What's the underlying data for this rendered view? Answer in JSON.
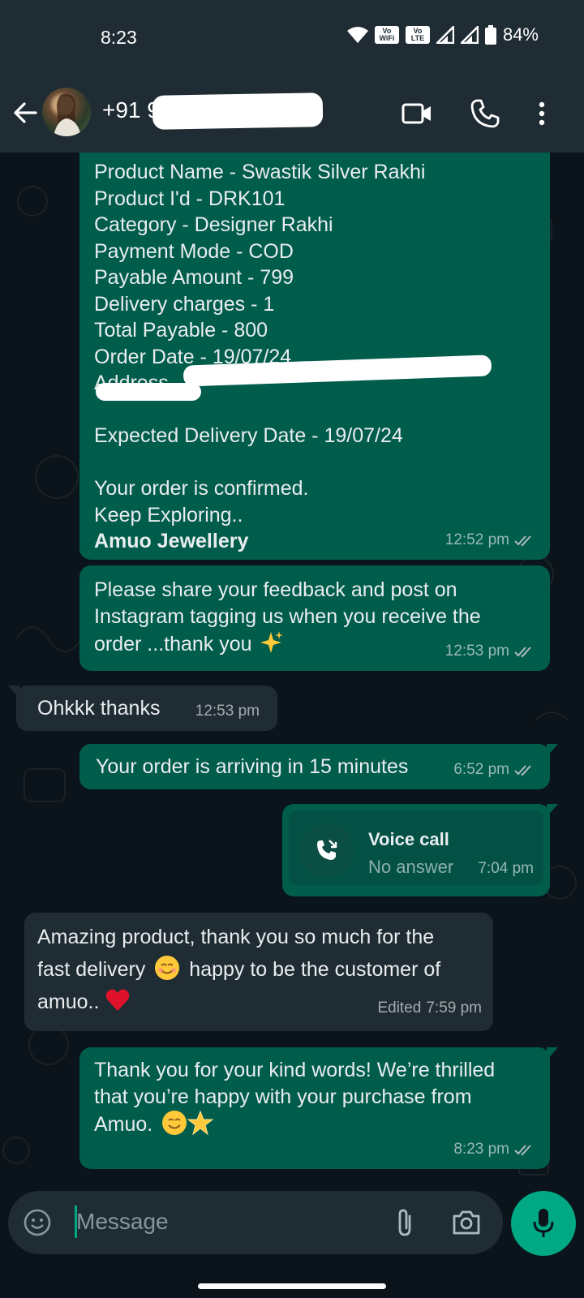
{
  "status_bar": {
    "time": "8:23",
    "wifi_badge": "Vo WiFi",
    "lte_badge": "Vo LTE",
    "battery": "84%"
  },
  "header": {
    "contact_prefix": "+91",
    "contact_rest": "9"
  },
  "messages": {
    "order": {
      "lines": [
        "Product Name - Swastik Silver Rakhi",
        "Product I'd - DRK101",
        "Category - Designer Rakhi",
        "Payment Mode - COD",
        "Payable Amount - 799",
        "Delivery charges - 1",
        "Total Payable - 800",
        "Order Date - 19/07/24",
        "Address -"
      ],
      "expected": "Expected Delivery Date - 19/07/24",
      "confirmed": "Your order is confirmed.",
      "keep": "Keep Exploring..",
      "signature": "Amuo Jewellery",
      "time": "12:52 pm"
    },
    "feedback": {
      "lines": [
        "Please share your feedback and post on",
        "Instagram tagging us when you receive the",
        "order ...thank you"
      ],
      "time": "12:53 pm"
    },
    "ohkkk": {
      "text": "Ohkkk thanks",
      "time": "12:53 pm"
    },
    "arriving": {
      "text": "Your order is arriving in 15 minutes",
      "time": "6:52 pm"
    },
    "voice_call": {
      "title": "Voice call",
      "status": "No answer",
      "time": "7:04 pm"
    },
    "amazing": {
      "line1": "Amazing product, thank you so much for the",
      "line2a": "fast delivery",
      "line2b": "happy to be the customer of",
      "line3": "amuo..",
      "edited": "Edited",
      "time": "7:59 pm"
    },
    "thankyou": {
      "line1": "Thank you for your kind words! We’re thrilled",
      "line2": "that you’re happy with your purchase from",
      "line3": "Amuo.",
      "time": "8:23 pm"
    }
  },
  "input": {
    "placeholder": "Message"
  },
  "colors": {
    "outgoing_bubble": "#005c4b",
    "incoming_bubble": "#202c33",
    "accent": "#00a884",
    "background": "#0b141a",
    "bar": "#1f2c34"
  }
}
